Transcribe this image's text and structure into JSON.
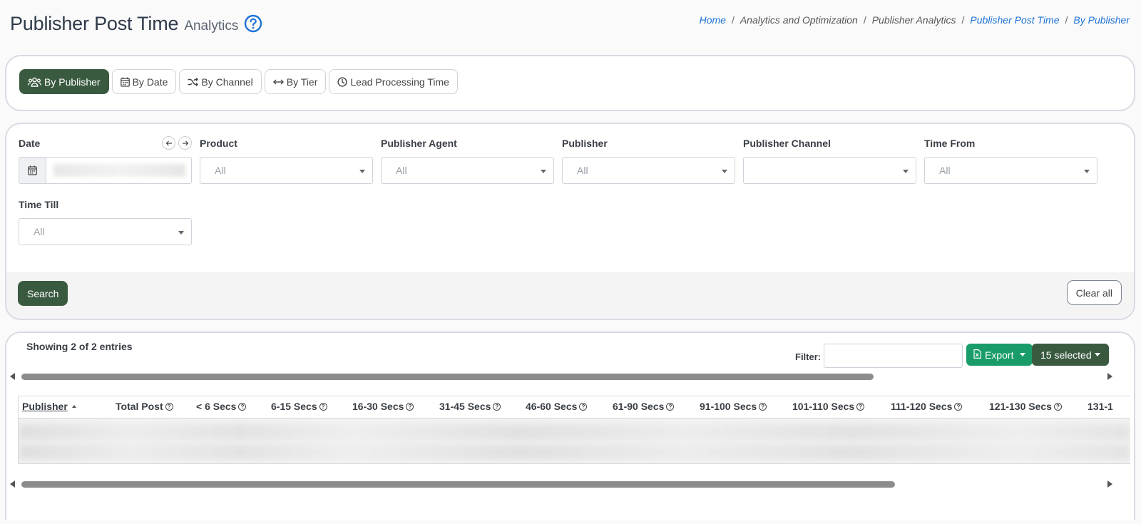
{
  "header": {
    "title": "Publisher Post Time",
    "subtitle": "Analytics"
  },
  "breadcrumb": [
    {
      "label": "Home",
      "link": true
    },
    {
      "label": "Analytics and Optimization",
      "link": false
    },
    {
      "label": "Publisher Analytics",
      "link": false
    },
    {
      "label": "Publisher Post Time",
      "link": true
    },
    {
      "label": "By Publisher",
      "link": true
    }
  ],
  "tabs": [
    {
      "label": "By Publisher",
      "icon": "users-icon",
      "active": true
    },
    {
      "label": "By Date",
      "icon": "calendar-icon",
      "active": false
    },
    {
      "label": "By Channel",
      "icon": "shuffle-icon",
      "active": false
    },
    {
      "label": "By Tier",
      "icon": "arrows-horizontal-icon",
      "active": false
    },
    {
      "label": "Lead Processing Time",
      "icon": "clock-icon",
      "active": false
    }
  ],
  "filters": {
    "date": {
      "label": "Date"
    },
    "product": {
      "label": "Product",
      "value": "All"
    },
    "publisher_agent": {
      "label": "Publisher Agent",
      "value": "All"
    },
    "publisher": {
      "label": "Publisher",
      "value": "All"
    },
    "publisher_channel": {
      "label": "Publisher Channel",
      "value": ""
    },
    "time_from": {
      "label": "Time From",
      "value": "All"
    },
    "time_till": {
      "label": "Time Till",
      "value": "All"
    }
  },
  "buttons": {
    "search": "Search",
    "clear_all": "Clear all",
    "export": "Export",
    "selected": "15 selected"
  },
  "table": {
    "showing": "Showing 2 of 2 entries",
    "filter_label": "Filter:",
    "columns": [
      {
        "label": "Publisher",
        "help": false,
        "sorted": "asc"
      },
      {
        "label": "Total Post",
        "help": true
      },
      {
        "label": "< 6 Secs",
        "help": true
      },
      {
        "label": "6-15 Secs",
        "help": true
      },
      {
        "label": "16-30 Secs",
        "help": true
      },
      {
        "label": "31-45 Secs",
        "help": true
      },
      {
        "label": "46-60 Secs",
        "help": true
      },
      {
        "label": "61-90 Secs",
        "help": true
      },
      {
        "label": "91-100 Secs",
        "help": true
      },
      {
        "label": "101-110 Secs",
        "help": true
      },
      {
        "label": "111-120 Secs",
        "help": true
      },
      {
        "label": "121-130 Secs",
        "help": true
      },
      {
        "label": "131-1",
        "help": false
      }
    ]
  },
  "colors": {
    "primary_green": "#3a5a40",
    "export_green": "#199c6a",
    "link_blue": "#1e73d8"
  }
}
